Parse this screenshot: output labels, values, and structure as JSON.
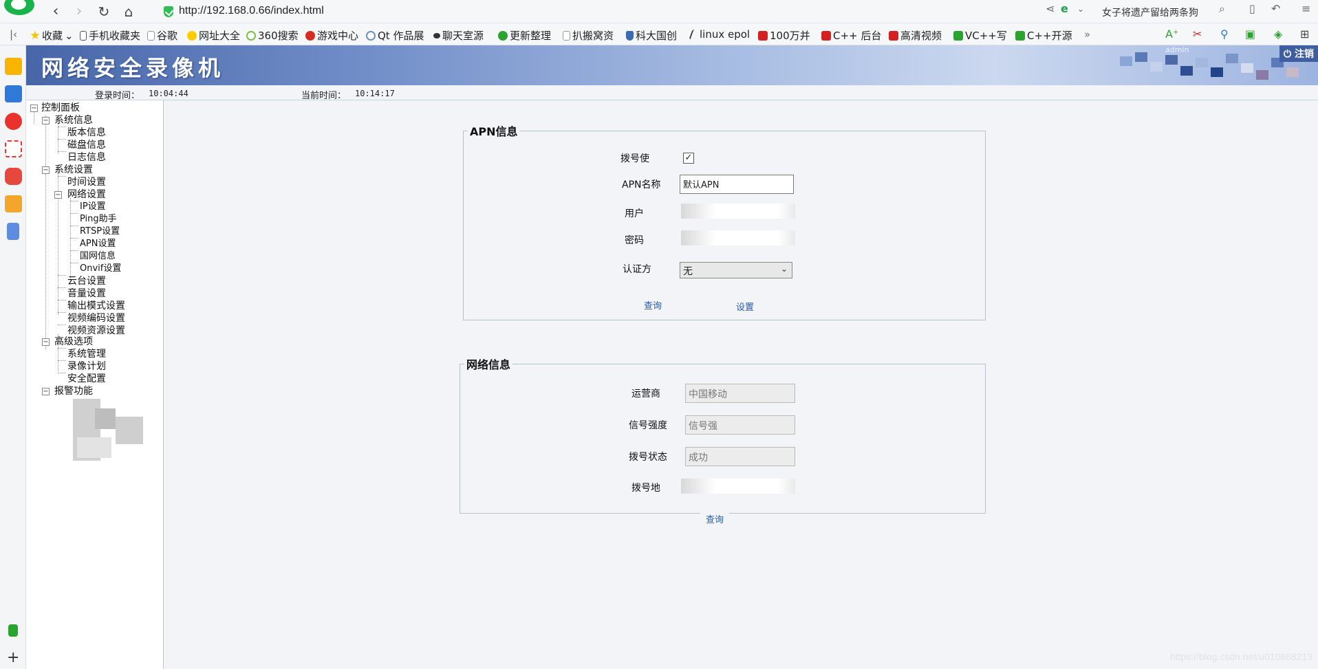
{
  "browser": {
    "url": "http://192.168.0.66/index.html",
    "search_hint": "女子将遗产留给两条狗",
    "bookmarks": [
      "收藏",
      "手机收藏夹",
      "谷歌",
      "网址大全",
      "360搜索",
      "游戏中心",
      "Qt 作品展",
      "聊天室源",
      "更新整理",
      "扒搬窝资",
      "科大国创",
      "linux epol",
      "100万并",
      "C++ 后台",
      "高清视频",
      "VC++写",
      "C++开源"
    ],
    "bookmark_more": "»"
  },
  "app": {
    "title": "网络安全录像机",
    "logout": "注销",
    "admin": "admin",
    "login_time_label": "登录时间：",
    "login_time": "10:04:44",
    "current_time_label": "当前时间：",
    "current_time": "10:14:17"
  },
  "tree": {
    "root": "控制面板",
    "sys_info": "系统信息",
    "version": "版本信息",
    "disk": "磁盘信息",
    "log": "日志信息",
    "sys_settings": "系统设置",
    "time": "时间设置",
    "network": "网络设置",
    "ip": "IP设置",
    "ping": "Ping助手",
    "rtsp": "RTSP设置",
    "apn": "APN设置",
    "gw": "国网信息",
    "onvif": "Onvif设置",
    "ptz": "云台设置",
    "volume": "音量设置",
    "output": "输出模式设置",
    "video_enc": "视频编码设置",
    "video_res": "视频资源设置",
    "advanced": "高级选项",
    "sys_mgmt": "系统管理",
    "rec_plan": "录像计划",
    "security": "安全配置",
    "alarm": "报警功能"
  },
  "apn": {
    "legend": "APN信息",
    "enable_label": "拨号使",
    "enable_checked": true,
    "check_mark": "✓",
    "name_label": "APN名称",
    "name_value": "默认APN",
    "user_label": "用户",
    "pass_label": "密码",
    "auth_label": "认证方",
    "auth_value": "无",
    "query_btn": "查询",
    "set_btn": "设置"
  },
  "net": {
    "legend": "网络信息",
    "carrier_label": "运营商",
    "carrier_value": "中国移动",
    "signal_label": "信号强度",
    "signal_value": "信号强",
    "dial_status_label": "拨号状态",
    "dial_status_value": "成功",
    "dial_addr_label": "拨号地",
    "query_btn": "查询"
  },
  "watermark": "https://blog.csdn.net/u010868213"
}
